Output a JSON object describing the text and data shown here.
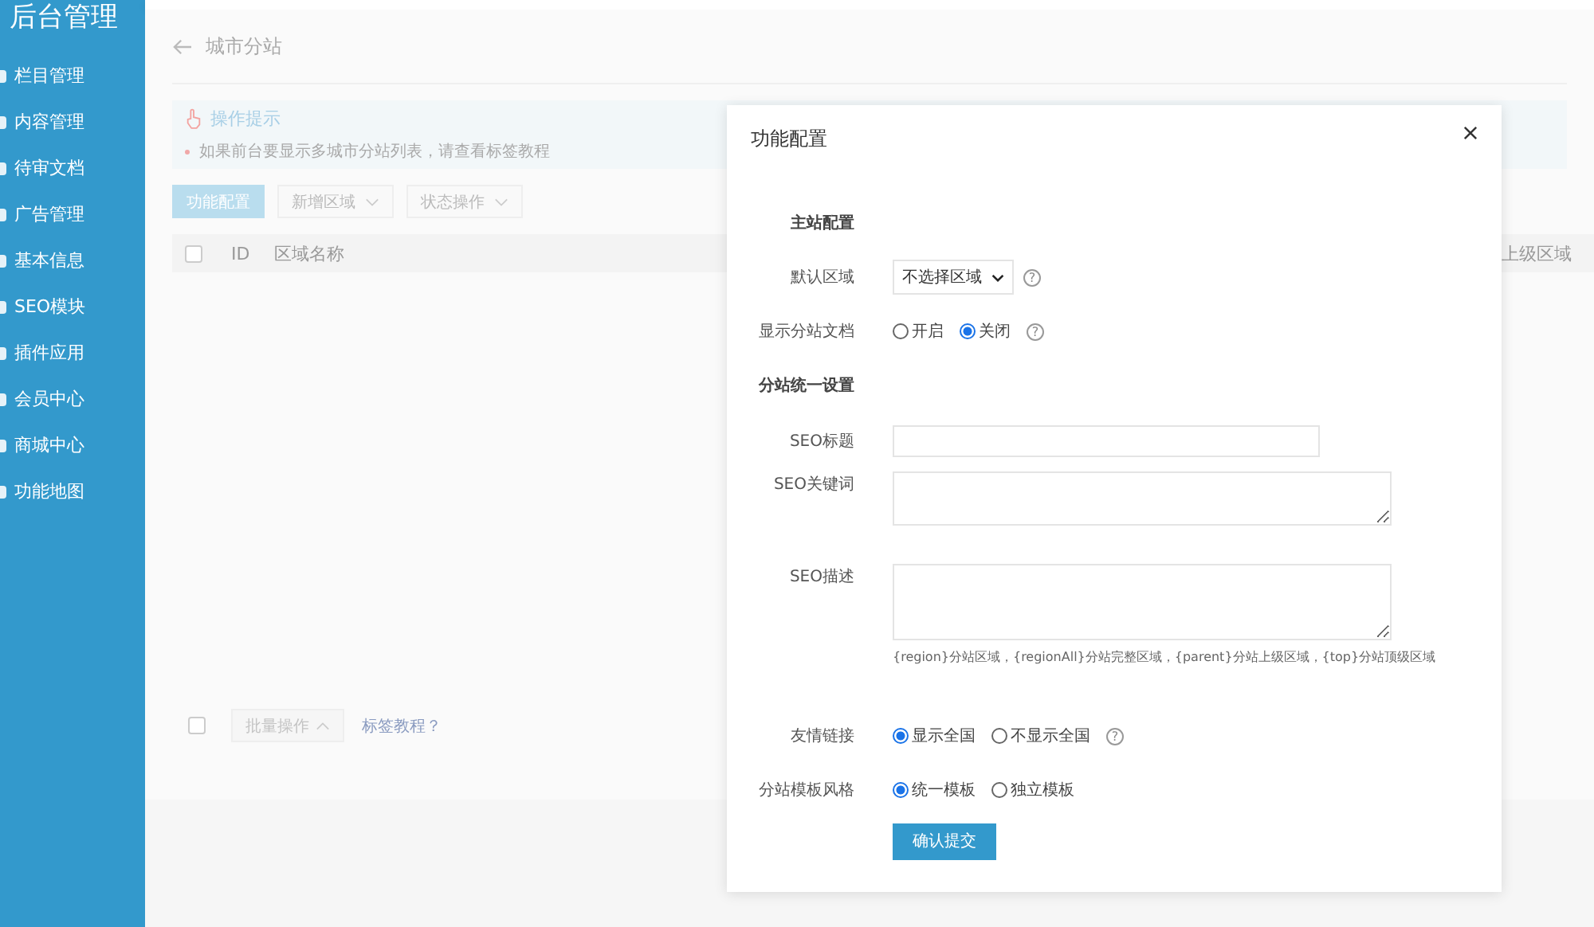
{
  "sidebar": {
    "logo": "后台管理",
    "items": [
      {
        "label": "栏目管理"
      },
      {
        "label": "内容管理"
      },
      {
        "label": "待审文档"
      },
      {
        "label": "广告管理"
      },
      {
        "label": "基本信息"
      },
      {
        "label": "SEO模块"
      },
      {
        "label": "插件应用"
      },
      {
        "label": "会员中心"
      },
      {
        "label": "商城中心"
      },
      {
        "label": "功能地图"
      }
    ]
  },
  "page": {
    "title": "城市分站",
    "tips": {
      "title": "操作提示",
      "items": [
        "如果前台要显示多城市分站列表，请查看标签教程"
      ]
    },
    "toolbar": [
      {
        "label": "功能配置",
        "kind": "primary"
      },
      {
        "label": "新增区域",
        "kind": "dropdown"
      },
      {
        "label": "状态操作",
        "kind": "dropdown"
      }
    ],
    "table": {
      "checked": false,
      "columns": [
        "ID",
        "区域名称",
        "上级区域"
      ]
    },
    "footer": {
      "checked": false,
      "batch": "批量操作",
      "link": "标签教程？"
    }
  },
  "modal": {
    "title": "功能配置",
    "rows": [
      {
        "kind": "heading",
        "label": "主站配置"
      },
      {
        "kind": "select",
        "label": "默认区域",
        "value": "不选择区域",
        "help": "?"
      },
      {
        "kind": "radio",
        "label": "显示分站文档",
        "help": "?",
        "options": [
          {
            "label": "开启",
            "selected": false
          },
          {
            "label": "关闭",
            "selected": true
          }
        ]
      },
      {
        "kind": "heading",
        "label": "分站统一设置"
      },
      {
        "kind": "text",
        "label": "SEO标题"
      },
      {
        "kind": "textarea",
        "label": "SEO关键词"
      },
      {
        "kind": "longtext",
        "label": "SEO描述",
        "hint": "{region}分站区域，{regionAll}分站完整区域，{parent}分站上级区域，{top}分站顶级区域"
      },
      {
        "kind": "radio",
        "label": "友情链接",
        "help": "?",
        "options": [
          {
            "label": "显示全国",
            "selected": true
          },
          {
            "label": "不显示全国",
            "selected": false
          }
        ]
      },
      {
        "kind": "radio",
        "label": "分站模板风格",
        "options": [
          {
            "label": "统一模板",
            "selected": true
          },
          {
            "label": "独立模板",
            "selected": false
          }
        ]
      },
      {
        "kind": "submit",
        "label": "确认提交"
      }
    ]
  }
}
